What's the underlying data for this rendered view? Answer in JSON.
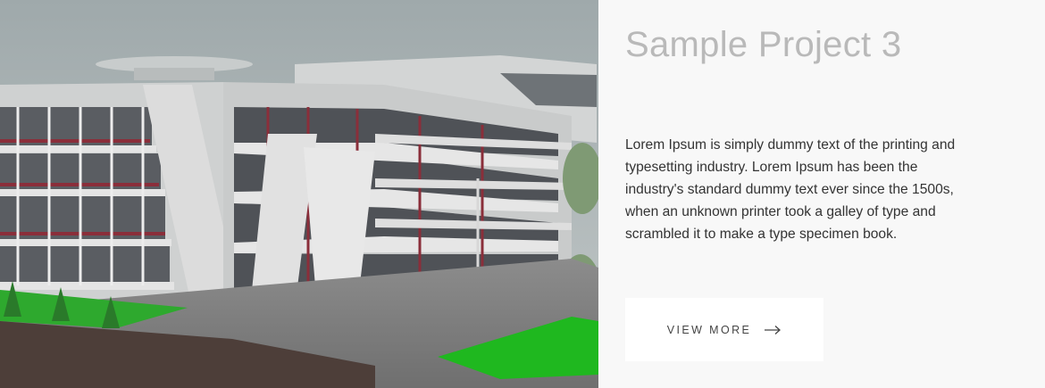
{
  "project": {
    "image_alt": "Rendering of a multi-storey modern building with balconies",
    "title": "Sample Project 3",
    "description": "Lorem Ipsum is simply dummy text of the printing and typesetting industry. Lorem Ipsum has been the industry's standard dummy text ever since the 1500s, when an unknown printer took a galley of type and scrambled it to make a type specimen book.",
    "button_label": "VIEW MORE",
    "button_icon": "arrow-right-icon"
  },
  "colors": {
    "background": "#f8f8f8",
    "title": "#b9b9b9",
    "text": "#333333",
    "button_bg": "#ffffff"
  }
}
